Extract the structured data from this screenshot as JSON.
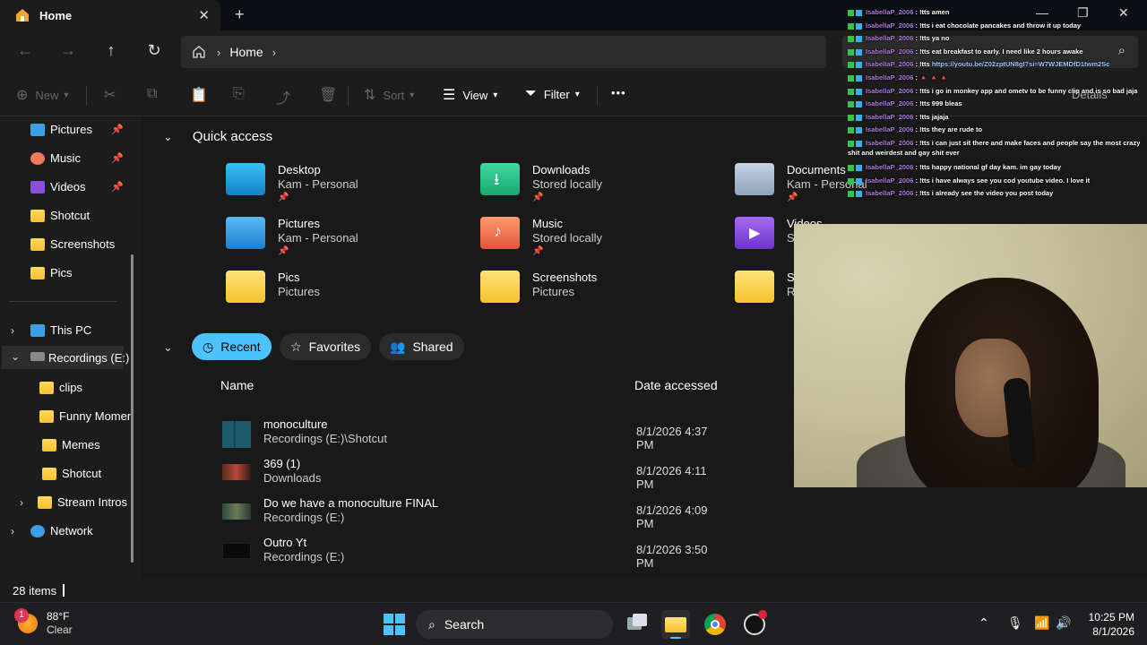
{
  "window": {
    "tab_title": "Home",
    "tab_close": "✕",
    "new_tab": "+",
    "minimize": "—",
    "maximize": "❐",
    "close": "✕"
  },
  "nav": {
    "back": "←",
    "forward": "→",
    "up": "↑",
    "refresh": "↻",
    "breadcrumb": [
      "Home"
    ],
    "search_icon": "search-icon"
  },
  "commands": {
    "new": "New",
    "sort": "Sort",
    "view": "View",
    "filter": "Filter",
    "more": "•••",
    "details": "Details"
  },
  "sidebar": {
    "pinned": [
      {
        "label": "Pictures",
        "icon": "pictures-icon",
        "pinned": true
      },
      {
        "label": "Music",
        "icon": "music-icon",
        "pinned": true
      },
      {
        "label": "Videos",
        "icon": "videos-icon",
        "pinned": true
      },
      {
        "label": "Shotcut",
        "icon": "folder-icon"
      },
      {
        "label": "Screenshots",
        "icon": "folder-icon"
      },
      {
        "label": "Pics",
        "icon": "folder-icon"
      }
    ],
    "tree": [
      {
        "label": "This PC",
        "icon": "pc-icon"
      },
      {
        "label": "Recordings (E:)",
        "icon": "drive-icon",
        "selected": true
      },
      {
        "label": "clips",
        "icon": "folder-icon"
      },
      {
        "label": "Funny Momen",
        "icon": "folder-icon"
      },
      {
        "label": "Memes",
        "icon": "folder-icon"
      },
      {
        "label": "Shotcut",
        "icon": "folder-icon"
      },
      {
        "label": "Stream Intros",
        "icon": "folder-icon"
      },
      {
        "label": "Network",
        "icon": "network-icon"
      }
    ]
  },
  "quick_access": {
    "heading": "Quick access",
    "items": [
      {
        "name": "Desktop",
        "sub": "Kam - Personal",
        "pinned": true,
        "color": "#1aa3e8"
      },
      {
        "name": "Downloads",
        "sub": "Stored locally",
        "pinned": true,
        "color": "#2ec48a"
      },
      {
        "name": "Documents",
        "sub": "Kam - Personal",
        "pinned": true,
        "color": "#9fb3c8"
      },
      {
        "name": "Pictures",
        "sub": "Kam - Personal",
        "pinned": true,
        "color": "#3aa0e8"
      },
      {
        "name": "Music",
        "sub": "Stored locally",
        "pinned": true,
        "color": "#f07a5a"
      },
      {
        "name": "Videos",
        "sub": "S",
        "pinned": false,
        "color": "#8b4fe0"
      },
      {
        "name": "Pics",
        "sub": "Pictures",
        "pinned": false,
        "color": "#f5c22e"
      },
      {
        "name": "Screenshots",
        "sub": "Pictures",
        "pinned": false,
        "color": "#f5c22e"
      },
      {
        "name": "S",
        "sub": "R",
        "pinned": false,
        "color": "#f5c22e"
      }
    ]
  },
  "filters": {
    "recent": "Recent",
    "favorites": "Favorites",
    "shared": "Shared"
  },
  "columns": {
    "name": "Name",
    "date": "Date accessed"
  },
  "recent_files": [
    {
      "name": "monoculture",
      "location": "Recordings (E:)\\Shotcut",
      "date": "8/1/2026 4:37 PM"
    },
    {
      "name": "369 (1)",
      "location": "Downloads",
      "date": "8/1/2026 4:11 PM"
    },
    {
      "name": "Do we have a monoculture FINAL",
      "location": "Recordings (E:)",
      "date": "8/1/2026 4:09 PM"
    },
    {
      "name": "Outro Yt",
      "location": "Recordings (E:)",
      "date": "8/1/2026 3:50 PM"
    }
  ],
  "status": {
    "item_count": "28 items"
  },
  "taskbar": {
    "temp": "88°F",
    "condition": "Clear",
    "weather_badge": "1",
    "search_label": "Search",
    "time": "10:25 PM",
    "date": "8/1/2026"
  },
  "chat": [
    {
      "user": "IsabellaP_2006",
      "msg": "!tts amen"
    },
    {
      "user": "IsabellaP_2006",
      "msg": "!tts i eat chocolate pancakes and throw it up today"
    },
    {
      "user": "IsabellaP_2006",
      "msg": "!tts ya no"
    },
    {
      "user": "IsabellaP_2006",
      "msg": "!tts eat breakfast to early. I need like 2 hours awake"
    },
    {
      "user": "IsabellaP_2006",
      "msg": "!tts ",
      "link": "https://youtu.be/Z02zptUN8gI?si=W7WJEMDfD1twm2Sc"
    },
    {
      "user": "IsabellaP_2006",
      "msg": "🔺 🔺 🔺"
    },
    {
      "user": "IsabellaP_2006",
      "msg": "!tts i go in monkey app and ometv to be funny clip and is so bad jaja"
    },
    {
      "user": "IsabellaP_2006",
      "msg": "!tts 999 bleas"
    },
    {
      "user": "IsabellaP_2006",
      "msg": "!tts jajaja"
    },
    {
      "user": "IsabellaP_2006",
      "msg": "!tts they are rude to"
    },
    {
      "user": "IsabellaP_2006",
      "msg": "!tts i can just sit there and make faces and people say the most crazy shit and weirdest and gay shit ever"
    },
    {
      "user": "IsabellaP_2006",
      "msg": "!tts happy national gf day kam. im gay today"
    },
    {
      "user": "IsabellaP_2006",
      "msg": "!tts i have always see you cod youtube video. I love it"
    },
    {
      "user": "IsabellaP_2006",
      "msg": "!tts i already see the video you post today"
    }
  ],
  "colors": {
    "accent": "#4cc2ff",
    "folder": "#f5c22e",
    "chat_user": "#b07ad8"
  }
}
